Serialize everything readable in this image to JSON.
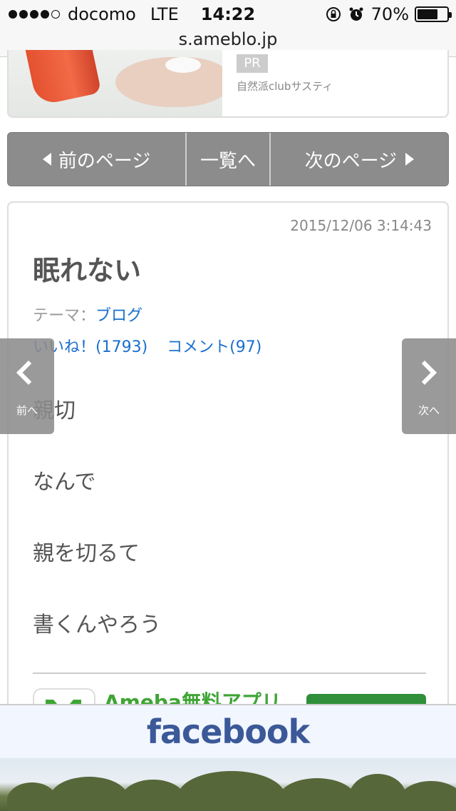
{
  "status_bar": {
    "carrier": "docomo",
    "network": "LTE",
    "time": "14:22",
    "battery": "70%",
    "battery_level": 0.7,
    "signal_bars": 4,
    "signal_max": 5
  },
  "url_bar": {
    "domain": "s.ameblo.jp"
  },
  "ad": {
    "pr_badge": "PR",
    "sponsor": "自然派clubサスティ"
  },
  "pager": {
    "prev": "前のページ",
    "list": "一覧へ",
    "next": "次のページ"
  },
  "article": {
    "date": "2015/12/06 3:14:43",
    "title": "眠れない",
    "theme_label": "テーマ：",
    "theme": "ブログ",
    "likes": "いいね！(1793)",
    "comments": "コメント(97)",
    "body": [
      "親切",
      "なんで",
      "親を切るて",
      "書くんやろう"
    ]
  },
  "ameba_app": {
    "text": "Ameba無料アプリ"
  },
  "side_nav": {
    "prev": "前へ",
    "next": "次へ"
  },
  "facebook_banner": {
    "logo": "facebook"
  },
  "colors": {
    "link": "#1a6fcc",
    "pager_bg": "#8c8c8c",
    "ameba_green": "#3fa535",
    "facebook_blue": "#3b5998"
  }
}
